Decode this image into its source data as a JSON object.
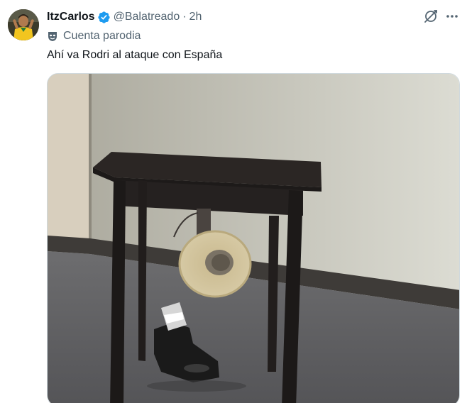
{
  "tweet": {
    "author": {
      "display_name": "ItzCarlos",
      "handle": "@Balatreado",
      "verified": true,
      "avatar_icon": "avatar"
    },
    "separator": "·",
    "time": "2h",
    "parody_label": "Cuenta parodia",
    "text": "Ahí va Rodri al ataque con España",
    "media": {
      "type": "video-thumbnail",
      "alt": "Video de una mesa de madera con un rollo de cinta colgando y un zapato debajo"
    }
  },
  "icons": {
    "verified": "verified-badge-icon",
    "parody": "parody-mask-icon",
    "grok": "grok-icon",
    "more": "more-options-icon"
  },
  "colors": {
    "text_primary": "#0f1419",
    "text_secondary": "#536471",
    "verified_blue": "#1d9bf0"
  }
}
